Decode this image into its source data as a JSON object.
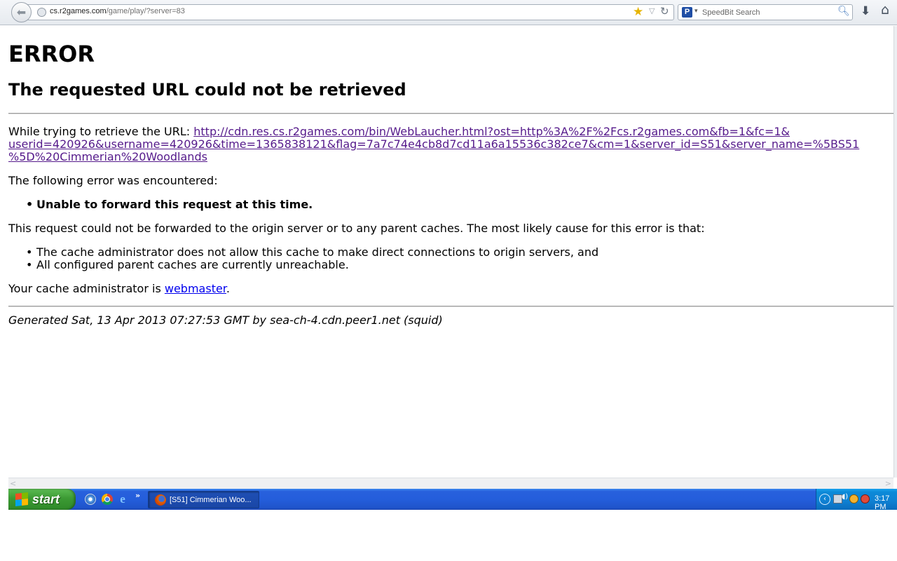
{
  "browser": {
    "url_host": "cs.r2games.com",
    "url_path": "/game/play/?server=83",
    "search_placeholder": "SpeedBit Search"
  },
  "page": {
    "title": "ERROR",
    "subtitle": "The requested URL could not be retrieved",
    "retrieve_label": "While trying to retrieve the URL: ",
    "retrieve_url_line1": "http://cdn.res.cs.r2games.com/bin/WebLaucher.html?ost=http%3A%2F%2Fcs.r2games.com&fb=1&fc=1&",
    "retrieve_url_line2": "userid=420926&username=420926&time=1365838121&flag=7a7c74e4cb8d7cd11a6a15536c382ce7&cm=1&server_id=S51&server_name=%5BS51",
    "retrieve_url_line3": "%5D%20Cimmerian%20Woodlands",
    "error_intro": "The following error was encountered:",
    "errors": [
      "Unable to forward this request at this time."
    ],
    "cause_intro": "This request could not be forwarded to the origin server or to any parent caches. The most likely cause for this error is that:",
    "causes": [
      "The cache administrator does not allow this cache to make direct connections to origin servers, and",
      "All configured parent caches are currently unreachable."
    ],
    "admin_prefix": "Your cache administrator is ",
    "admin_link": "webmaster",
    "admin_suffix": ".",
    "footer": "Generated Sat, 13 Apr 2013 07:27:53 GMT by sea-ch-4.cdn.peer1.net (squid)"
  },
  "taskbar": {
    "start_label": "start",
    "task_label": "[S51] Cimmerian Woo...",
    "quicklaunch_more": "»",
    "clock": "3:17 PM"
  },
  "icons": {
    "back": "back-arrow-icon",
    "site": "globe-icon",
    "bookmark": "star-icon",
    "reload": "reload-icon",
    "search": "magnifier-icon",
    "downloads": "download-arrow-icon",
    "home": "home-icon"
  },
  "colors": {
    "visited_link": "#551a8b",
    "link": "#0000ee",
    "taskbar": "#245edb",
    "start_button": "#3c9a34",
    "tray": "#0f80d2"
  }
}
